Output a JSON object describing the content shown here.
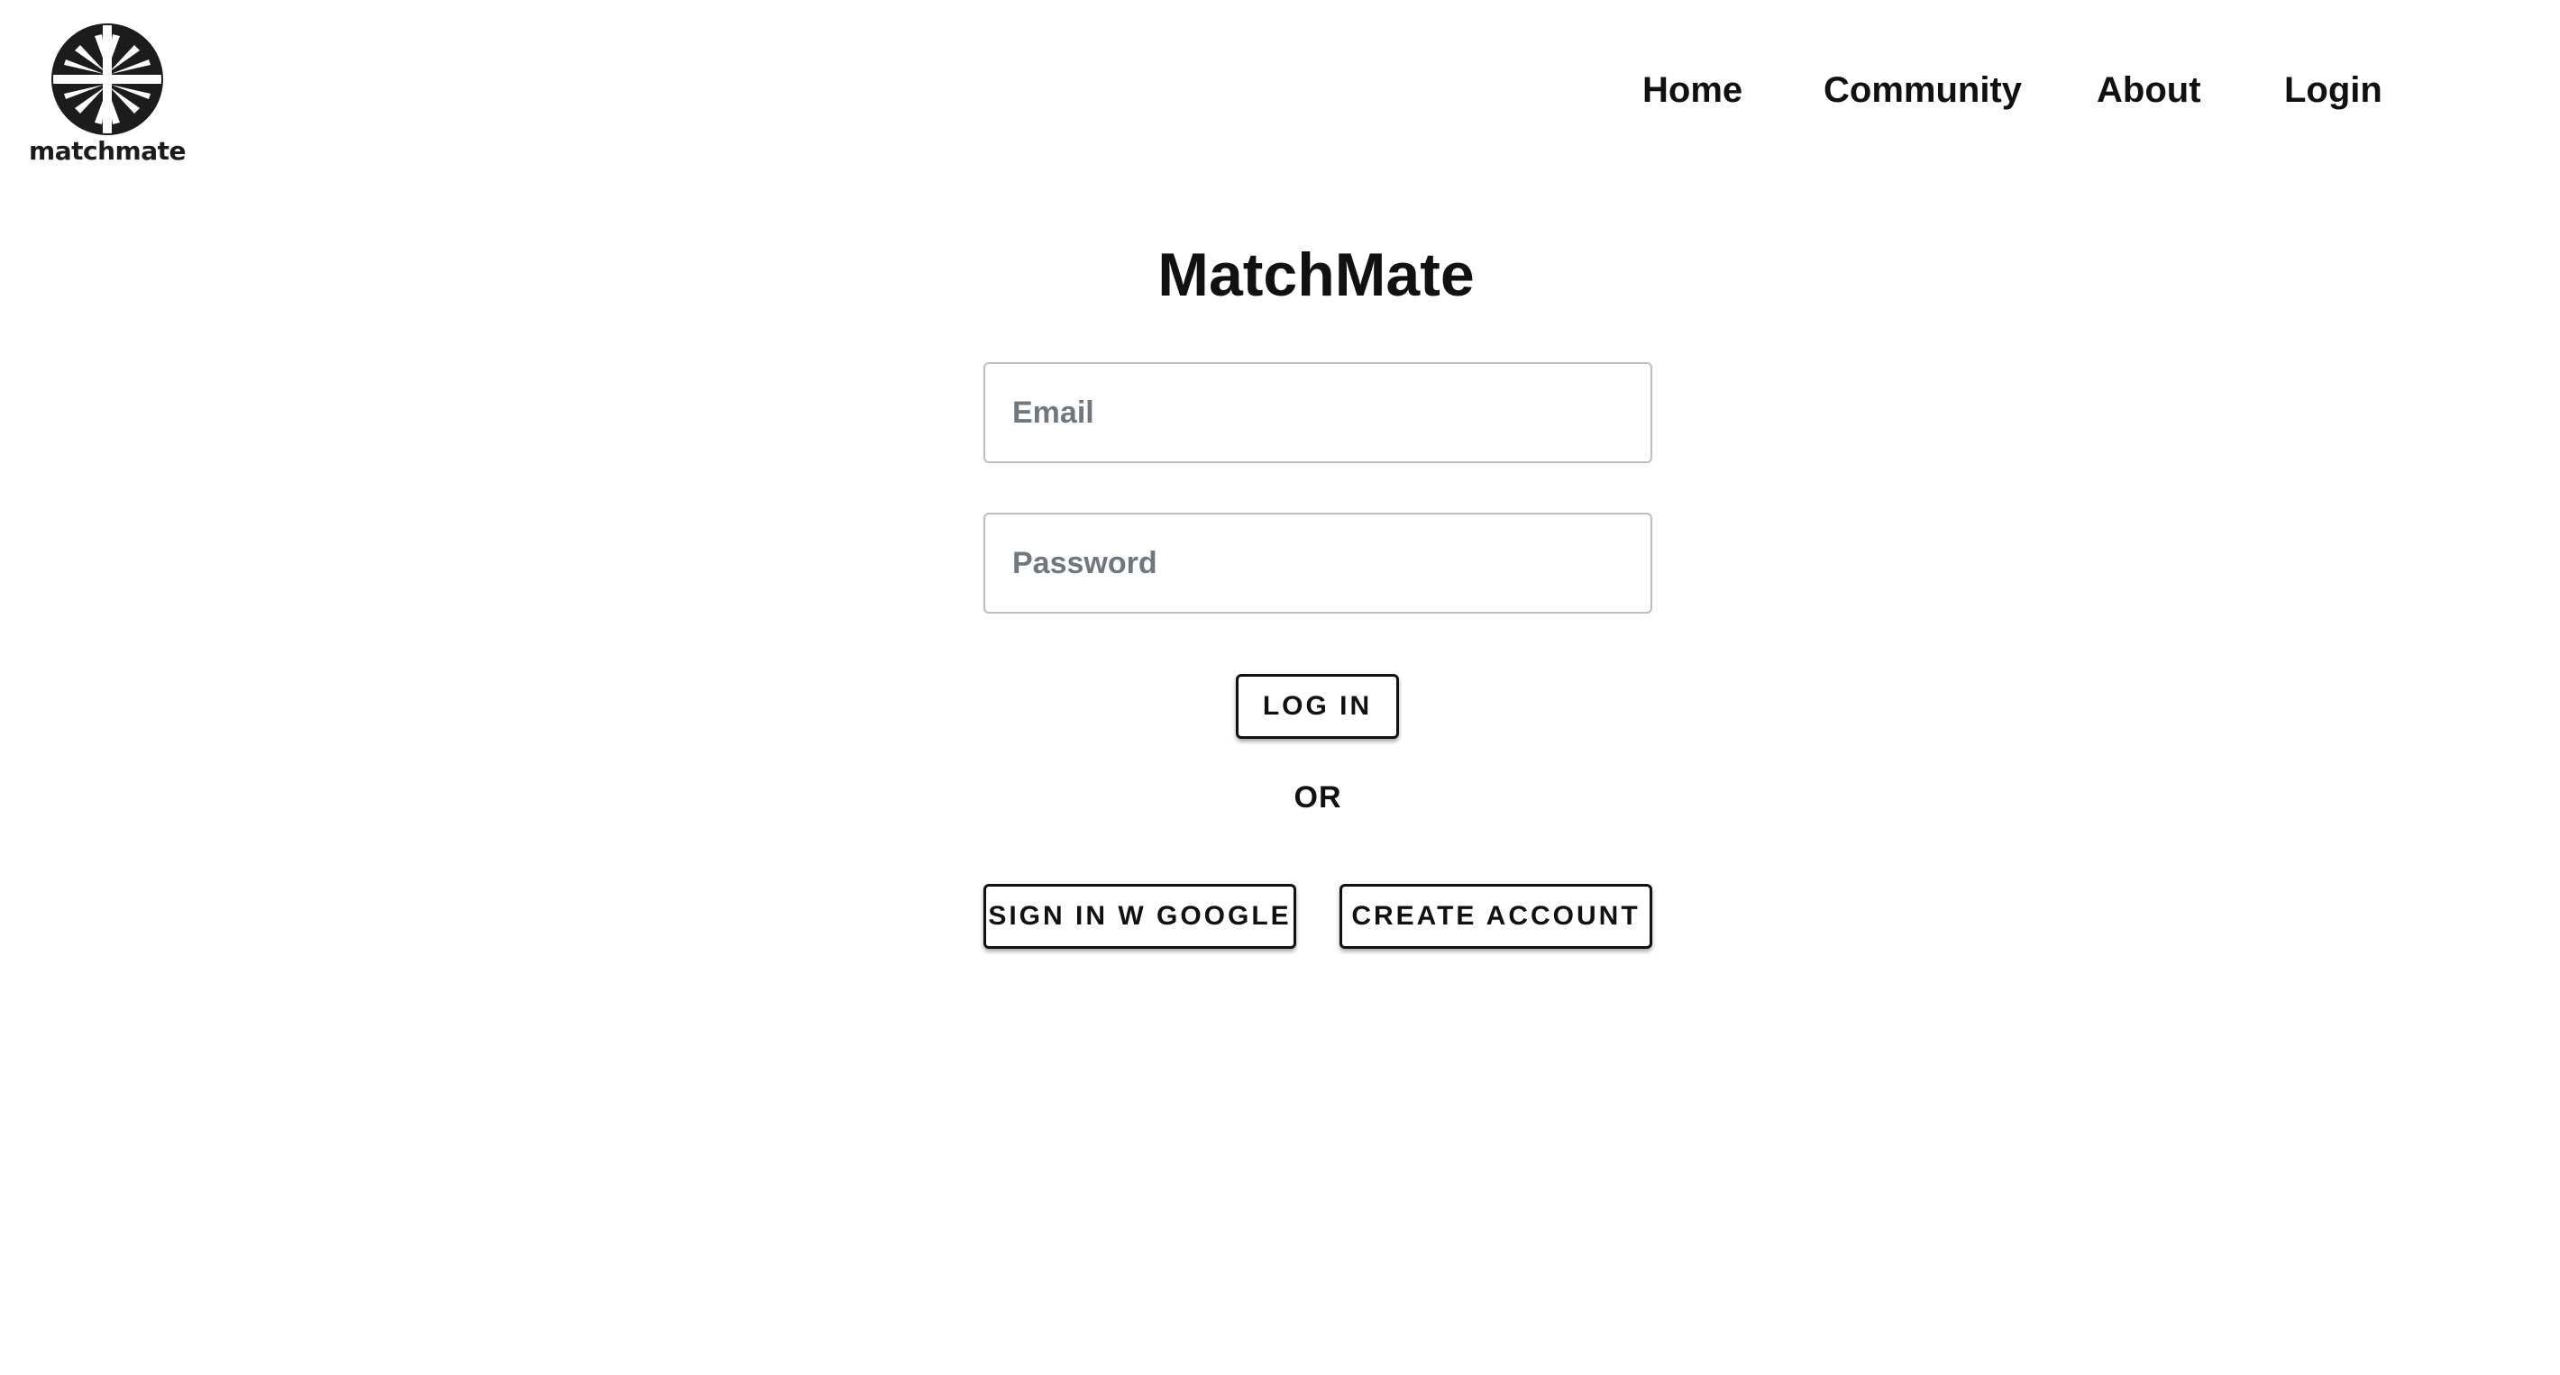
{
  "header": {
    "logo": {
      "icon": "matchmate-logo-icon",
      "text": "matchmate",
      "color": "#1c1c1c"
    },
    "nav": [
      {
        "label": "Home"
      },
      {
        "label": "Community"
      },
      {
        "label": "About"
      },
      {
        "label": "Login"
      }
    ]
  },
  "main": {
    "title": "MatchMate",
    "email": {
      "placeholder": "Email",
      "value": ""
    },
    "password": {
      "placeholder": "Password",
      "value": ""
    },
    "login_button": "LOG IN",
    "separator": "OR",
    "google_button": "SIGN IN W GOOGLE",
    "create_button": "CREATE ACCOUNT"
  },
  "colors": {
    "background": "#ffffff",
    "text": "#111111",
    "input_border": "#bdbdbd",
    "placeholder": "#6f7780"
  }
}
